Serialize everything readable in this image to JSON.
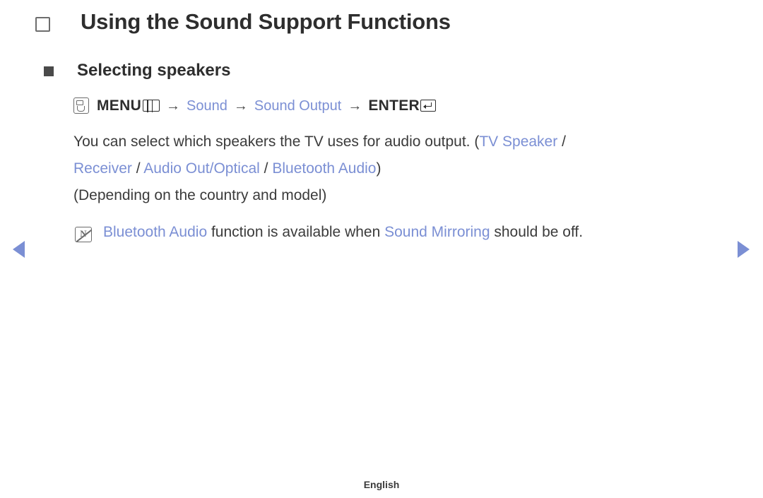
{
  "page": {
    "title": "Using the Sound Support Functions",
    "subtitle": "Selecting speakers",
    "menu_path": {
      "menu_label": "MENU",
      "arrow": "→",
      "step1": "Sound",
      "step2": "Sound Output",
      "enter_label": "ENTER"
    },
    "paragraph1_a": "You can select which speakers the TV uses for audio output. (",
    "paragraph1_b": "TV Speaker",
    "paragraph1_c": " / ",
    "paragraph2_a": "Receiver",
    "paragraph2_b": " / ",
    "paragraph2_c": "Audio Out/Optical",
    "paragraph2_d": " / ",
    "paragraph2_e": "Bluetooth Audio",
    "paragraph2_f": ")",
    "paragraph3": "(Depending on the country and model)",
    "note": {
      "part1": "Bluetooth Audio",
      "part2": " function is available when ",
      "part3": "Sound Mirroring",
      "part4": " should be off."
    },
    "footer": "English",
    "accent_color": "#7b8fd4",
    "text_color": "#3b3b3b"
  }
}
